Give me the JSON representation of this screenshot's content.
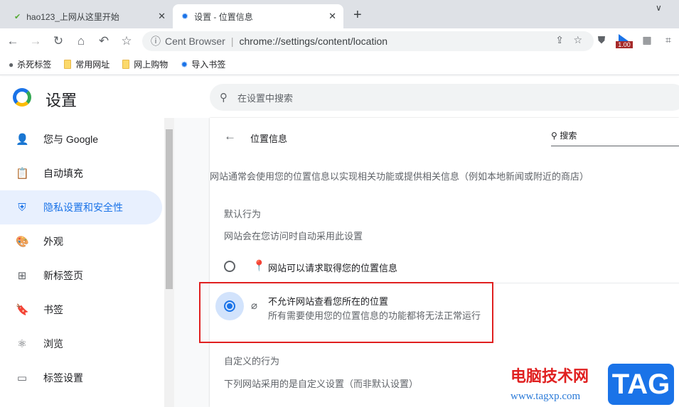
{
  "tabs": [
    {
      "title": "hao123_上网从这里开始",
      "icon": "hao-logo-icon"
    },
    {
      "title": "设置 - 位置信息",
      "icon": "gear-icon"
    }
  ],
  "toolbar": {
    "site_label": "Cent Browser",
    "url": "chrome://settings/content/location",
    "extension_badge": "1.00"
  },
  "bookmarks": [
    {
      "label": "杀死标签",
      "icon": "globe-icon"
    },
    {
      "label": "常用网址",
      "icon": "folder-icon"
    },
    {
      "label": "网上购物",
      "icon": "folder-icon"
    },
    {
      "label": "导入书签",
      "icon": "gear-icon"
    }
  ],
  "header": {
    "title": "设置",
    "search_placeholder": "在设置中搜索"
  },
  "sidebar": {
    "items": [
      {
        "label": "您与 Google",
        "icon": "person-icon"
      },
      {
        "label": "自动填充",
        "icon": "clipboard-icon"
      },
      {
        "label": "隐私设置和安全性",
        "icon": "shield-icon",
        "selected": true
      },
      {
        "label": "外观",
        "icon": "palette-icon"
      },
      {
        "label": "新标签页",
        "icon": "new-tab-icon"
      },
      {
        "label": "书签",
        "icon": "bookmark-icon"
      },
      {
        "label": "浏览",
        "icon": "atom-icon"
      },
      {
        "label": "标签设置",
        "icon": "tab-icon"
      }
    ]
  },
  "main": {
    "title": "位置信息",
    "search_placeholder": "搜索",
    "description": "网站通常会使用您的位置信息以实现相关功能或提供相关信息（例如本地新闻或附近的商店）",
    "default_heading": "默认行为",
    "default_sub": "网站会在您访问时自动采用此设置",
    "options": [
      {
        "label": "网站可以请求取得您的位置信息",
        "selected": false
      },
      {
        "label": "不允许网站查看您所在的位置",
        "sub": "所有需要使用您的位置信息的功能都将无法正常运行",
        "selected": true
      }
    ],
    "custom_heading": "自定义的行为",
    "custom_sub": "下列网站采用的是自定义设置（而非默认设置）"
  },
  "watermark": {
    "cn": "电脑技术网",
    "url": "www.tagxp.com",
    "logo": "TAG"
  },
  "colors": {
    "accent": "#1a73e8",
    "highlight_box": "#e02020"
  }
}
